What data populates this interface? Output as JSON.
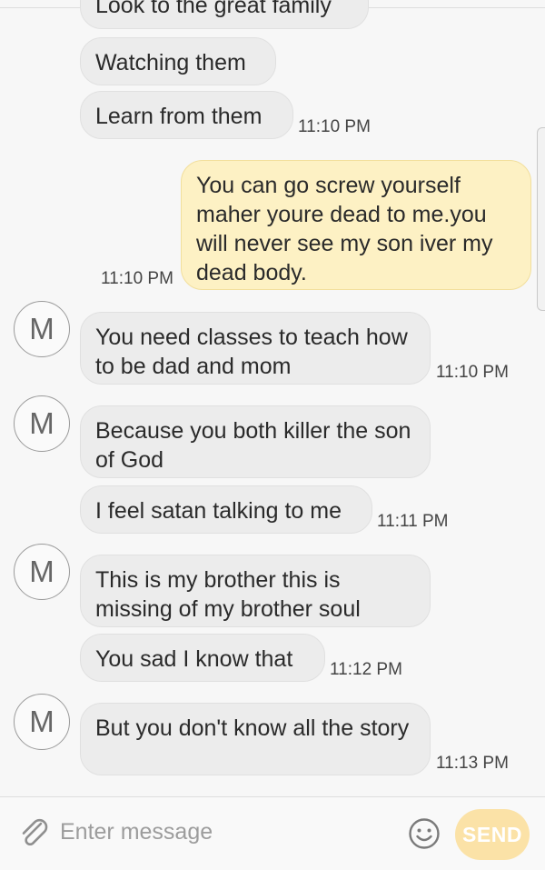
{
  "conversation": {
    "contact_initial": "M",
    "messages": [
      {
        "text": "Look to the great family",
        "time": ""
      },
      {
        "text": "Watching them",
        "time": ""
      },
      {
        "text": "Learn from them",
        "time": "11:10 PM"
      },
      {
        "text": "You can go screw yourself maher youre dead to me.you will never see my son iver my dead body.",
        "time": "11:10 PM"
      },
      {
        "text": "You need classes to teach how to be dad and mom",
        "time": "11:10 PM"
      },
      {
        "text": "Because you both killer the son of God",
        "time": ""
      },
      {
        "text": "I feel satan talking to me",
        "time": "11:11 PM"
      },
      {
        "text": "This is my brother this is missing of my brother soul",
        "time": ""
      },
      {
        "text": "You sad I know that",
        "time": "11:12 PM"
      },
      {
        "text": "But you don't know all the story",
        "time": "11:13 PM"
      }
    ]
  },
  "composer": {
    "placeholder": "Enter message",
    "send_label": "SEND"
  },
  "icons": {
    "attach": "paperclip-icon",
    "emoji": "smiley-icon"
  },
  "colors": {
    "incoming_bubble": "#ececec",
    "outgoing_bubble": "#fdf1c4",
    "send_button": "#fbe2a7"
  }
}
